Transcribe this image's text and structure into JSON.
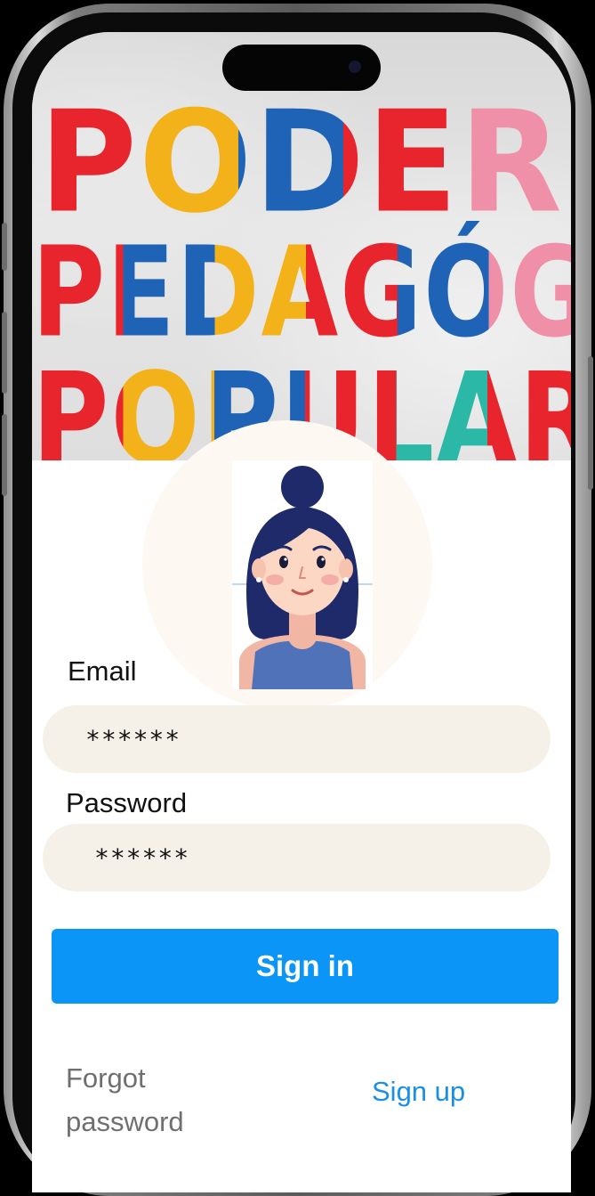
{
  "banner": {
    "line1": "PODER",
    "line2": "PEDAGÓGICO",
    "line3": "POPULAR"
  },
  "form": {
    "email_label": "Email",
    "email_value": "******",
    "password_label": "Password",
    "password_value": "******"
  },
  "actions": {
    "sign_in_label": "Sign in",
    "forgot_label": "Forgot password",
    "sign_up_label": "Sign up"
  },
  "colors": {
    "primary": "#0b96f7",
    "link": "#1a8fe6",
    "input_bg": "#f5f1e8",
    "muted_text": "#6f6f6f"
  },
  "icons": {
    "avatar": "woman-avatar-icon"
  }
}
